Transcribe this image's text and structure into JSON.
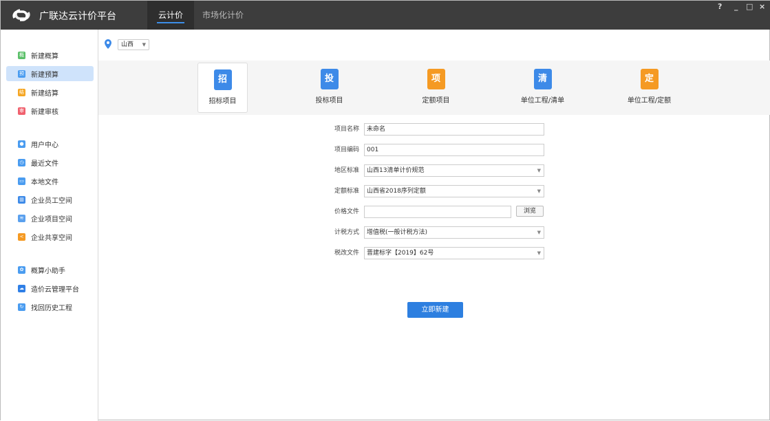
{
  "header": {
    "title": "广联达云计价平台",
    "tabs": [
      {
        "label": "云计价"
      },
      {
        "label": "市场化计价"
      }
    ],
    "help": "?",
    "minimize": "_",
    "maximize": "□",
    "close": "×"
  },
  "sidebar": {
    "items": [
      {
        "label": "新建概算",
        "glyph": "概",
        "color": "#5cc06a"
      },
      {
        "label": "新建预算",
        "glyph": "预",
        "color": "#4a9cf0"
      },
      {
        "label": "新建结算",
        "glyph": "结",
        "color": "#f5a623"
      },
      {
        "label": "新建审核",
        "glyph": "审",
        "color": "#f0616e"
      },
      {
        "label": "用户中心",
        "glyph": "●",
        "color": "#4a9cf0"
      },
      {
        "label": "最近文件",
        "glyph": "◷",
        "color": "#4a9cf0"
      },
      {
        "label": "本地文件",
        "glyph": "▭",
        "color": "#4a9cf0"
      },
      {
        "label": "企业员工空间",
        "glyph": "▥",
        "color": "#3d8ae8"
      },
      {
        "label": "企业项目空间",
        "glyph": "≋",
        "color": "#5aa0ee"
      },
      {
        "label": "企业共享空间",
        "glyph": "<",
        "color": "#f59a23"
      },
      {
        "label": "概算小助手",
        "glyph": "✿",
        "color": "#4a9cf0"
      },
      {
        "label": "造价云管理平台",
        "glyph": "☁",
        "color": "#2f7fe6"
      },
      {
        "label": "找回历史工程",
        "glyph": "↻",
        "color": "#4a9cf0"
      }
    ]
  },
  "region": {
    "value": "山西"
  },
  "cards": [
    {
      "label": "招标项目",
      "glyph": "招",
      "color": "#3d8ae8"
    },
    {
      "label": "投标项目",
      "glyph": "投",
      "color": "#3d8ae8"
    },
    {
      "label": "定额项目",
      "glyph": "项",
      "color": "#f59a23"
    },
    {
      "label": "单位工程/清单",
      "glyph": "清",
      "color": "#3d8ae8"
    },
    {
      "label": "单位工程/定额",
      "glyph": "定",
      "color": "#f59a23"
    }
  ],
  "form": {
    "name": {
      "label": "项目名称",
      "value": "未命名"
    },
    "code": {
      "label": "项目编码",
      "value": "001"
    },
    "region_std": {
      "label": "地区标准",
      "value": "山西13清单计价规范"
    },
    "quota_std": {
      "label": "定额标准",
      "value": "山西省2018序列定额"
    },
    "price_file": {
      "label": "价格文件",
      "value": "",
      "browse": "浏览"
    },
    "tax_method": {
      "label": "计税方式",
      "value": "增值税(一般计税方法)"
    },
    "tax_file": {
      "label": "税改文件",
      "value": "晋建标字【2019】62号"
    },
    "submit": "立即新建"
  }
}
